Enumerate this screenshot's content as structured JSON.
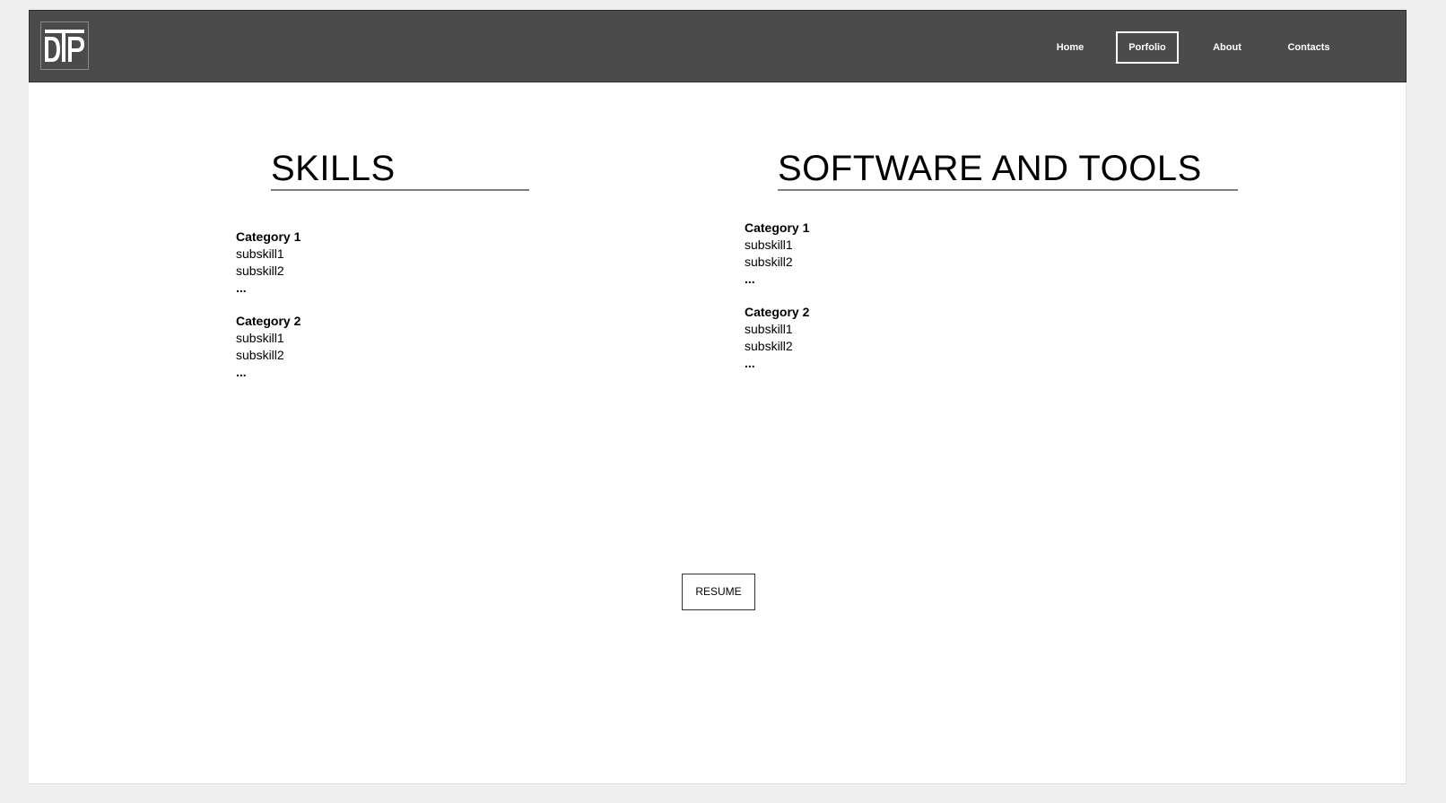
{
  "logo": {
    "text": "DTP",
    "icon": "dtp-logo-icon"
  },
  "nav": {
    "items": [
      {
        "label": "Home",
        "active": false
      },
      {
        "label": "Porfolio",
        "active": true
      },
      {
        "label": "About",
        "active": false
      },
      {
        "label": "Contacts",
        "active": false
      }
    ]
  },
  "skills": {
    "title": "SKILLS",
    "categories": [
      {
        "name": "Category 1",
        "items": [
          "subskill1",
          "subskill2"
        ],
        "more": "..."
      },
      {
        "name": "Category 2",
        "items": [
          "subskill1",
          "subskill2"
        ],
        "more": "..."
      }
    ]
  },
  "tools": {
    "title": "SOFTWARE AND TOOLS",
    "categories": [
      {
        "name": "Category 1",
        "items": [
          "subskill1",
          "subskill2"
        ],
        "more": "..."
      },
      {
        "name": "Category 2",
        "items": [
          "subskill1",
          "subskill2"
        ],
        "more": "..."
      }
    ]
  },
  "resume": {
    "label": "RESUME"
  },
  "colors": {
    "navbar": "#4b4b4b",
    "background": "#efefef",
    "page": "#ffffff",
    "rule": "#7f7f7f"
  }
}
